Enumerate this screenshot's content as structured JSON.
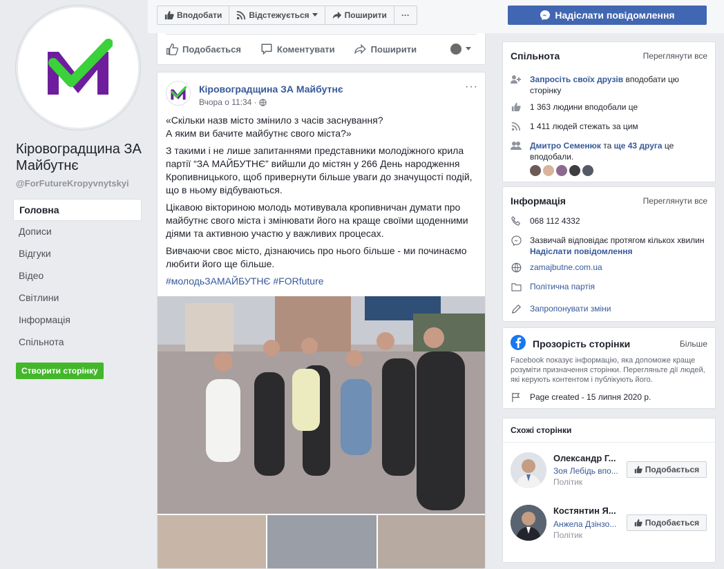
{
  "page": {
    "name": "Кіровоградщина ЗА Майбутнє",
    "handle": "@ForFutureKropyvnytskyi"
  },
  "nav": {
    "items": [
      {
        "label": "Головна"
      },
      {
        "label": "Дописи"
      },
      {
        "label": "Відгуки"
      },
      {
        "label": "Відео"
      },
      {
        "label": "Світлини"
      },
      {
        "label": "Інформація"
      },
      {
        "label": "Спільнота"
      }
    ],
    "create_label": "Створити сторінку"
  },
  "toolbar": {
    "like_label": "Вподобати",
    "follow_label": "Відстежується",
    "share_label": "Поширити",
    "more_label": "···",
    "send_message_label": "Надіслати повідомлення"
  },
  "prev_post": {
    "like_label": "Подобається",
    "comment_label": "Коментувати",
    "share_label": "Поширити"
  },
  "post": {
    "author": "Кіровоградщина ЗА Майбутнє",
    "time": "Вчора о 11:34 ·",
    "more": "···",
    "line1": "«Скільки назв місто змінило з часів заснування?",
    "line2": "А яким ви бачите майбутнє свого міста?»",
    "para2": "З такими і не лише запитаннями представники молодіжного крила партії “ЗА МАЙБУТНЄ” вийшли до містян у 266 День народження Кропивницького, щоб привернути більше уваги до значущості подій, що в ньому відбуваються.",
    "para3": "Цікавою вікториною молодь мотивувала кропивничан думати про майбутнє свого міста і змінювати його на краще своїми щоденними діями та активною участю у важливих процесах.",
    "para4": "Вивчаючи своє місто, дізнаючись про нього більше - ми починаємо любити його ще більше.",
    "tags": "#молодьЗАМАЙБУТНЄ #FORfuture"
  },
  "community": {
    "title": "Спільнота",
    "see_all": "Переглянути все",
    "invite_link": "Запросіть своїх друзів",
    "invite_rest": " вподобати цю сторінку",
    "likes": "1 363 людини вподобали це",
    "follows": "1 411 людей стежать за цим",
    "friend_name": "Дмитро Семенюк",
    "friend_mid": " та ",
    "friend_more": "ще 43 друга",
    "friend_rest": " це вподобали."
  },
  "info": {
    "title": "Інформація",
    "see_all": "Переглянути все",
    "phone": "068 112 4332",
    "response": "Зазвичай відповідає протягом кількох хвилин",
    "send_message": "Надіслати повідомлення",
    "website": "zamajbutne.com.ua",
    "category": "Політична партія",
    "suggest": "Запропонувати зміни"
  },
  "transparency": {
    "title": "Прозорість сторінки",
    "more": "Більше",
    "desc": "Facebook показує інформацію, яка допоможе краще розуміти призначення сторінки. Перегляньте дії людей, які керують контентом і публікують його.",
    "created": "Page created - 15 липня 2020 р."
  },
  "similar": {
    "title": "Схожі сторінки",
    "items": [
      {
        "name": "Олександр Г...",
        "sub": "Зоя Лебідь впо...",
        "category": "Політик",
        "like": "Подобається"
      },
      {
        "name": "Костянтин Я...",
        "sub": "Анжела Дзінзо...",
        "category": "Політик",
        "like": "Подобається"
      }
    ]
  },
  "colors": {
    "brand_blue": "#4267b2",
    "link": "#365899",
    "green_button": "#42b72a",
    "logo_green": "#3ad13a",
    "logo_purple": "#6e1e9c"
  }
}
